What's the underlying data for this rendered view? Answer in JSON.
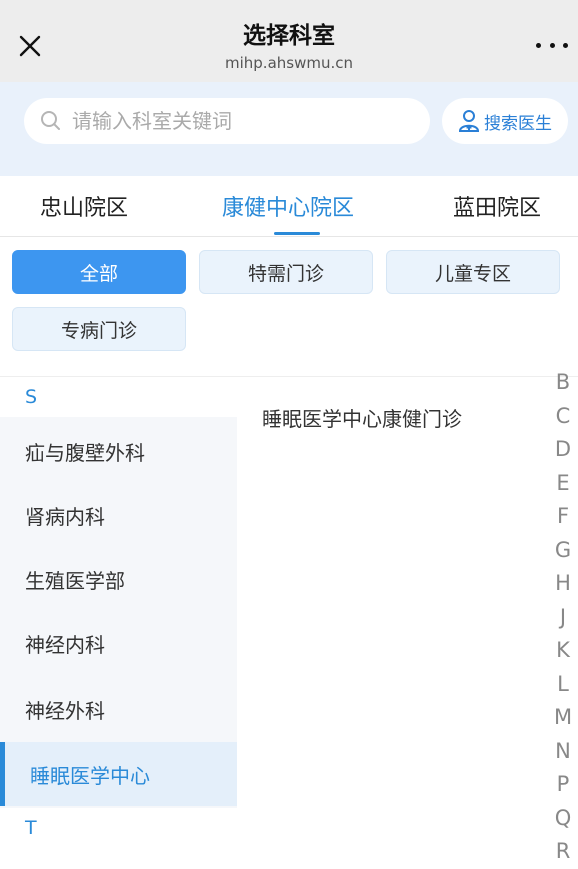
{
  "titlebar": {
    "title": "选择科室",
    "url": "mihp.ahswmu.cn",
    "close_icon": "close-icon",
    "more_icon": "more-dots-icon"
  },
  "search": {
    "placeholder": "请输入科室关键词",
    "value": "",
    "doctor_label": "搜索医生",
    "search_icon": "search-icon",
    "doctor_icon": "doctor-icon"
  },
  "campus_tabs": [
    {
      "label": "忠山院区",
      "active": false
    },
    {
      "label": "康健中心院区",
      "active": true
    },
    {
      "label": "蓝田院区",
      "active": false
    }
  ],
  "filters": [
    {
      "label": "全部",
      "active": true
    },
    {
      "label": "特需门诊",
      "active": false
    },
    {
      "label": "儿童专区",
      "active": false
    },
    {
      "label": "专病门诊",
      "active": false
    }
  ],
  "departments": {
    "letter_s": "S",
    "letter_t": "T",
    "items": [
      {
        "label": "疝与腹壁外科",
        "active": false
      },
      {
        "label": "肾病内科",
        "active": false
      },
      {
        "label": "生殖医学部",
        "active": false
      },
      {
        "label": "神经内科",
        "active": false
      },
      {
        "label": "神经外科",
        "active": false
      },
      {
        "label": "睡眠医学中心",
        "active": true
      }
    ]
  },
  "sub_departments": [
    {
      "label": "睡眠医学中心康健门诊"
    }
  ],
  "index_letters": [
    "B",
    "C",
    "D",
    "E",
    "F",
    "G",
    "H",
    "J",
    "K",
    "L",
    "M",
    "N",
    "P",
    "Q",
    "R"
  ],
  "colors": {
    "accent": "#2a8ad8",
    "chip_active": "#3d96f0",
    "chip_bg": "#eaf3fc",
    "search_area_bg": "#e9f1fb",
    "titlebar_bg": "#ededed"
  }
}
